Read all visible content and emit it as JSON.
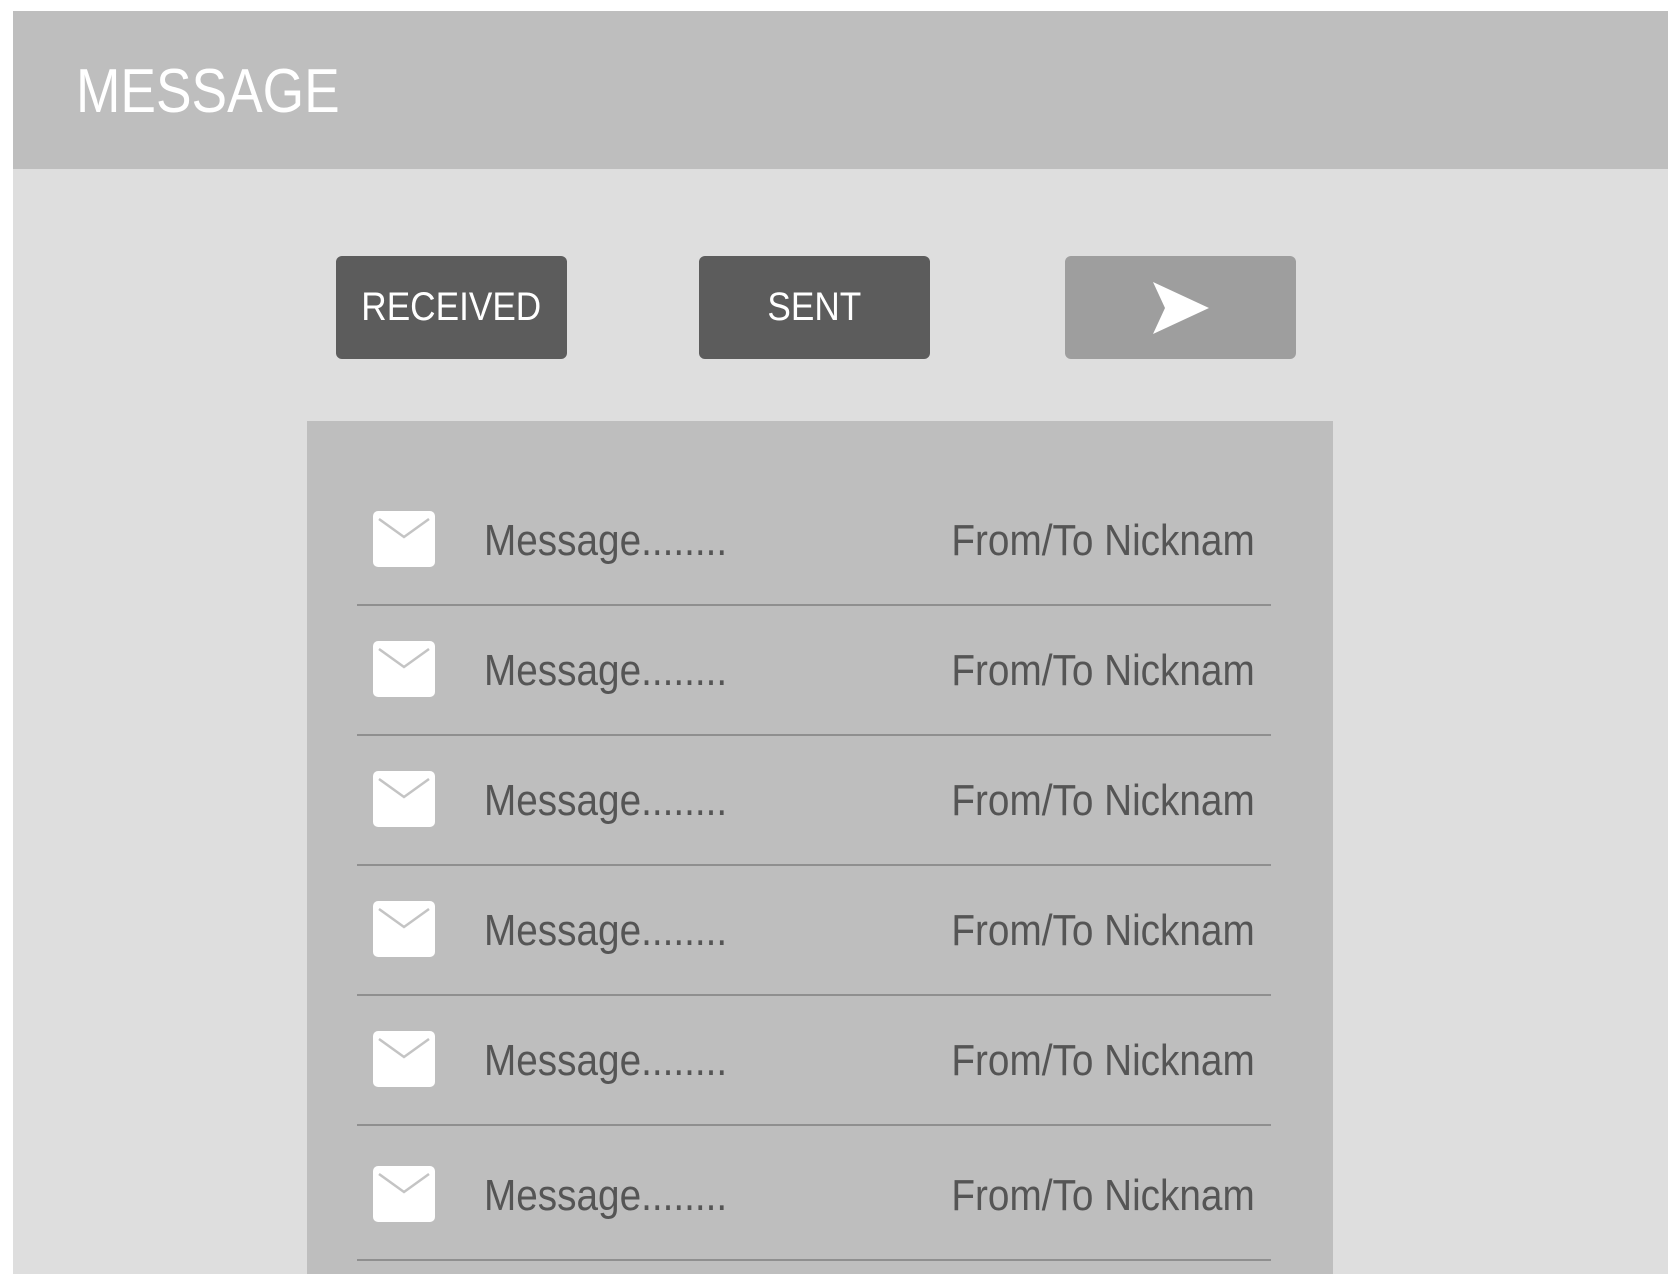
{
  "header": {
    "title": "MESSAGE"
  },
  "tabs": {
    "received_label": "RECEIVED",
    "sent_label": "SENT",
    "compose_icon": "send-arrow-icon"
  },
  "messages": [
    {
      "icon": "envelope-icon",
      "preview": "Message........",
      "contact": "From/To Nicknam"
    },
    {
      "icon": "envelope-icon",
      "preview": "Message........",
      "contact": "From/To Nicknam"
    },
    {
      "icon": "envelope-icon",
      "preview": "Message........",
      "contact": "From/To Nicknam"
    },
    {
      "icon": "envelope-icon",
      "preview": "Message........",
      "contact": "From/To Nicknam"
    },
    {
      "icon": "envelope-icon",
      "preview": "Message........",
      "contact": "From/To Nicknam"
    },
    {
      "icon": "envelope-icon",
      "preview": "Message........",
      "contact": "From/To Nicknam"
    }
  ],
  "colors": {
    "header_bg": "#bebebe",
    "body_bg": "#dedede",
    "button_dark": "#5c5c5c",
    "button_light": "#9e9e9e",
    "list_bg": "#bebebe",
    "text": "#555555"
  }
}
